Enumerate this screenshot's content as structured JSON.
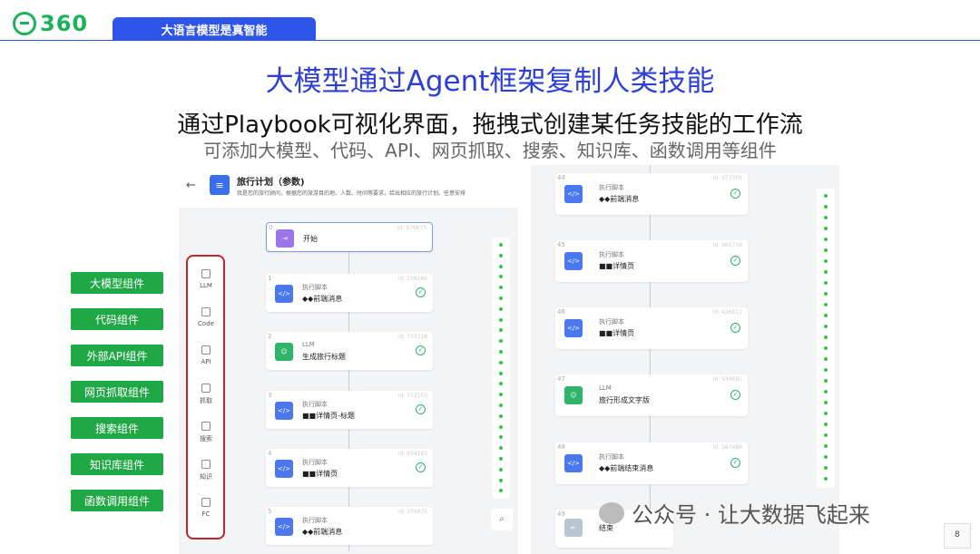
{
  "logo": {
    "text": "360"
  },
  "tag": "大语言模型是真智能",
  "title": "大模型通过Agent框架复制人类技能",
  "subtitle": "通过Playbook可视化界面，拖拽式创建某任务技能的工作流",
  "subtitle2": "可添加大模型、代码、API、网页抓取、搜索、知识库、函数调用等组件",
  "components": [
    "大模型组件",
    "代码组件",
    "外部API组件",
    "网页抓取组件",
    "搜索组件",
    "知识库组件",
    "函数调用组件"
  ],
  "editor": {
    "title": "旅行计划（参数)",
    "desc": "我是您的旅行顾问，根据您的旅游目的地、人数、时间等要求，给出相应的旅行计划。任意安排",
    "tools": [
      {
        "icon": "llm-icon",
        "label": "LLM"
      },
      {
        "icon": "code-icon",
        "label": "Code"
      },
      {
        "icon": "api-icon",
        "label": "API"
      },
      {
        "icon": "crawl-icon",
        "label": "抓取"
      },
      {
        "icon": "search-icon",
        "label": "搜索"
      },
      {
        "icon": "knowledge-icon",
        "label": "知识"
      },
      {
        "icon": "function-icon",
        "label": "FC"
      }
    ],
    "left_nodes": [
      {
        "num": "0",
        "id": "id: 976673",
        "type": "",
        "name": "开始",
        "kind": "start"
      },
      {
        "num": "1",
        "id": "id: 238186",
        "type": "执行脚本",
        "name": "◆◆前端消息",
        "kind": "code"
      },
      {
        "num": "2",
        "id": "id: 733318",
        "type": "LLM",
        "name": "生成旅行标题",
        "kind": "llm"
      },
      {
        "num": "3",
        "id": "id: 772155",
        "type": "执行脚本",
        "name": "■■详情页-标题",
        "kind": "code"
      },
      {
        "num": "4",
        "id": "id: 934183",
        "type": "执行脚本",
        "name": "■■详情页",
        "kind": "code"
      },
      {
        "num": "5",
        "id": "id: 376975",
        "type": "执行脚本",
        "name": "◆◆前端消息",
        "kind": "code"
      }
    ],
    "right_nodes": [
      {
        "num": "44",
        "id": "id: 577305",
        "type": "执行脚本",
        "name": "◆◆前端消息",
        "kind": "code"
      },
      {
        "num": "45",
        "id": "id: 961739",
        "type": "执行脚本",
        "name": "■■详情页",
        "kind": "code"
      },
      {
        "num": "46",
        "id": "id: 426811",
        "type": "执行脚本",
        "name": "■■详情页",
        "kind": "code"
      },
      {
        "num": "47",
        "id": "id: 934691",
        "type": "LLM",
        "name": "旅行形成文字版",
        "kind": "llm"
      },
      {
        "num": "48",
        "id": "id: 587488",
        "type": "执行脚本",
        "name": "◆◆前端结束消息",
        "kind": "code"
      },
      {
        "num": "49",
        "id": "",
        "type": "",
        "name": "结束",
        "kind": "end"
      }
    ]
  },
  "watermark": "公众号 · 让大数据飞起来",
  "page_number": "8"
}
